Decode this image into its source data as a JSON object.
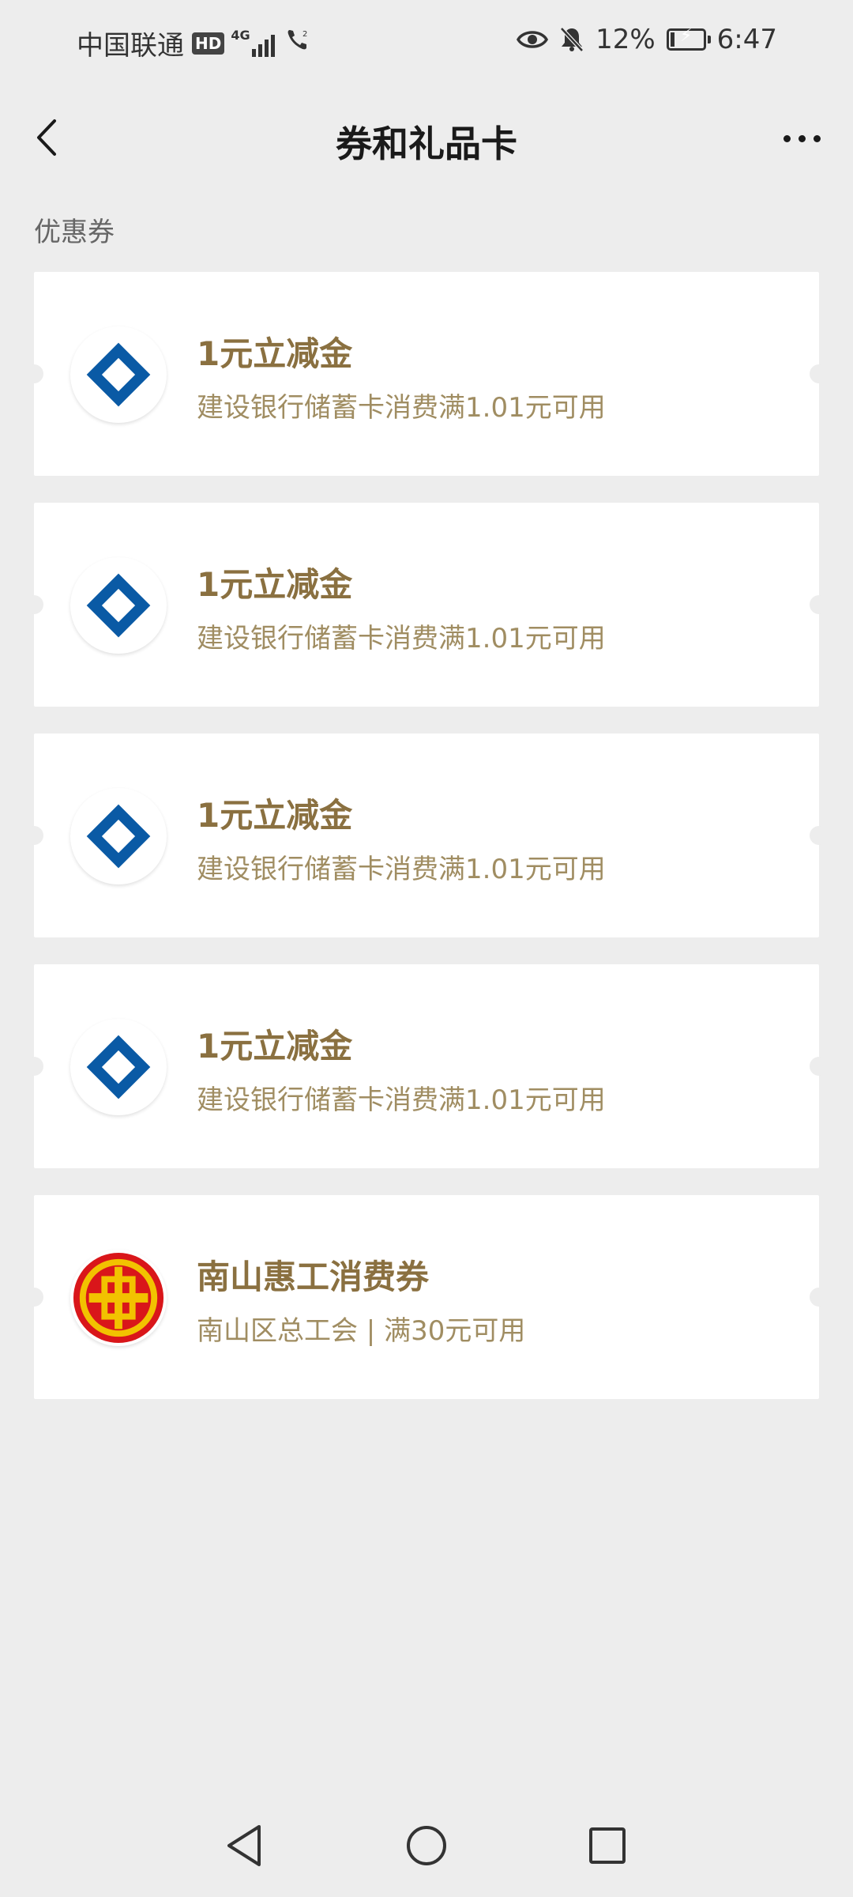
{
  "status_bar": {
    "carrier": "中国联通",
    "hd": "HD",
    "network": "4G",
    "battery_percent": "12%",
    "battery_level": 0.12,
    "time": "6:47",
    "icons": [
      "eye-icon",
      "bell-off-icon",
      "call-wifi-icon",
      "battery-charging-icon"
    ]
  },
  "header": {
    "title": "券和礼品卡",
    "back_icon": "chevron-left-icon",
    "more_icon": "more-dots-icon"
  },
  "section": {
    "label": "优惠券"
  },
  "coupons": [
    {
      "logo": "ccb-logo",
      "title": "1元立减金",
      "desc": "建设银行储蓄卡消费满1.01元可用"
    },
    {
      "logo": "ccb-logo",
      "title": "1元立减金",
      "desc": "建设银行储蓄卡消费满1.01元可用"
    },
    {
      "logo": "ccb-logo",
      "title": "1元立减金",
      "desc": "建设银行储蓄卡消费满1.01元可用"
    },
    {
      "logo": "ccb-logo",
      "title": "1元立减金",
      "desc": "建设银行储蓄卡消费满1.01元可用"
    },
    {
      "logo": "trade-union-logo",
      "title": "南山惠工消费券",
      "desc": "南山区总工会 | 满30元可用"
    }
  ],
  "system_nav": {
    "back_icon": "triangle-back-icon",
    "home_icon": "circle-home-icon",
    "recents_icon": "square-recents-icon"
  },
  "colors": {
    "background": "#ededed",
    "card": "#ffffff",
    "coupon_title": "#8a7040",
    "coupon_desc": "#a08d62",
    "ccb_blue": "#0a5aa5",
    "union_red": "#d9161a",
    "union_gold": "#f2c200"
  }
}
